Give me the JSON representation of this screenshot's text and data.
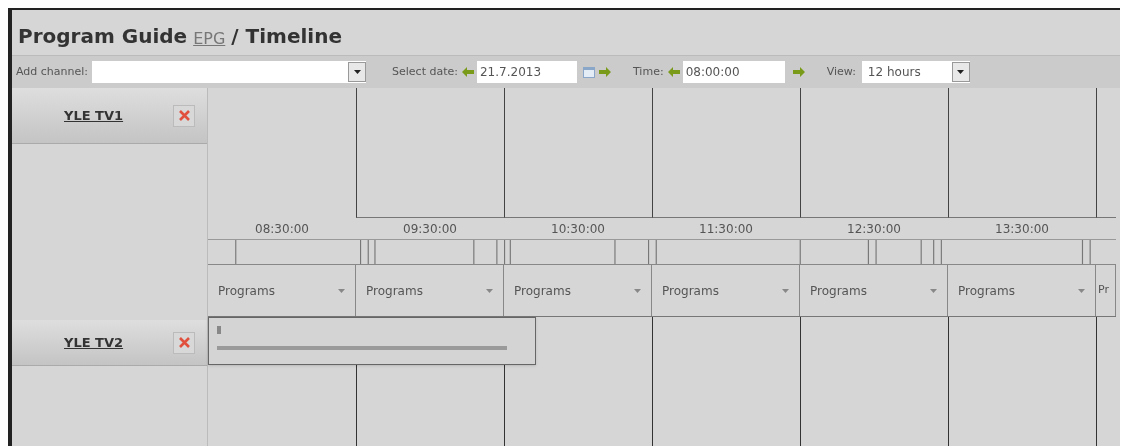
{
  "title": {
    "text": "Program Guide",
    "link": "EPG",
    "suffix": "/ Timeline"
  },
  "toolbar": {
    "add_channel": {
      "label": "Add channel:"
    },
    "date": {
      "label": "Select date:",
      "value": "21.7.2013"
    },
    "time": {
      "label": "Time:",
      "value": "08:00:00"
    },
    "view": {
      "label": "View:",
      "value": "12 hours"
    }
  },
  "channels": [
    {
      "name": "YLE TV1"
    },
    {
      "name": "YLE TV2"
    }
  ],
  "timeline": {
    "times": [
      "08:30:00",
      "09:30:00",
      "10:30:00",
      "11:30:00",
      "12:30:00",
      "13:30:00"
    ],
    "program_menus": [
      "Programs",
      "Programs",
      "Programs",
      "Programs",
      "Programs",
      "Programs",
      "Pr"
    ]
  }
}
